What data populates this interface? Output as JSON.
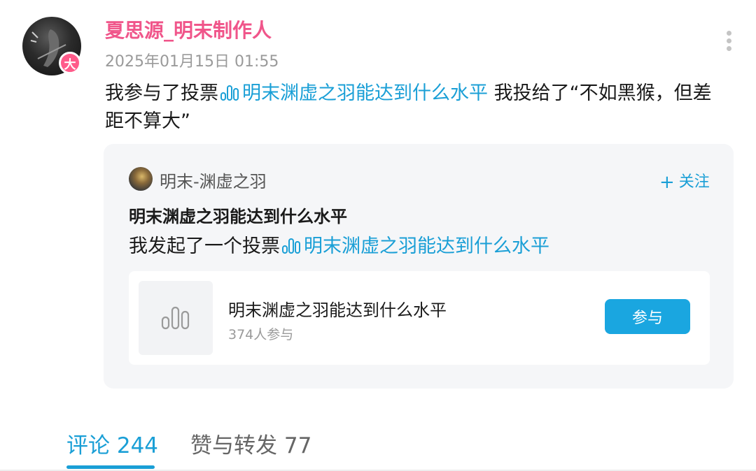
{
  "post": {
    "author": "夏思源_明末制作人",
    "badge": "大",
    "timestamp": "2025年01月15日 01:55",
    "text_prefix": "我参与了投票",
    "text_link": "明末渊虚之羽能达到什么水平",
    "text_suffix": " 我投给了“不如黑猴，但差距不算大”"
  },
  "quoted": {
    "source_name": "明末-渊虚之羽",
    "follow_label": "关注",
    "title": "明末渊虚之羽能达到什么水平",
    "body_prefix": "我发起了一个投票",
    "body_link": "明末渊虚之羽能达到什么水平",
    "poll": {
      "title": "明末渊虚之羽能达到什么水平",
      "participants": "374人参与",
      "join_label": "参与"
    }
  },
  "tabs": {
    "comments": "评论 244",
    "likes_reposts": "赞与转发 77"
  },
  "colors": {
    "author": "#f0558a",
    "link": "#1a9fd6",
    "button": "#1aa6e0",
    "badge": "#ff5b8a"
  },
  "icons": {
    "more": "more-vertical-icon",
    "vote": "poll-bars-icon",
    "follow": "plus-icon"
  }
}
